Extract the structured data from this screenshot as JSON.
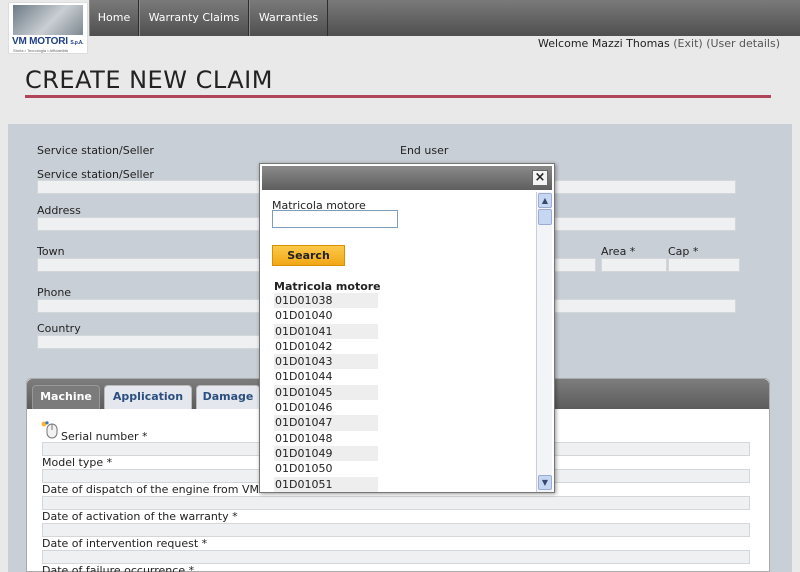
{
  "logo": {
    "brand": "VM MOTORI",
    "suffix": "S.p.A.",
    "tagline": "Storia • Tecnologia • Affidabilità"
  },
  "nav": {
    "home": "Home",
    "claims": "Warranty Claims",
    "warranties": "Warranties"
  },
  "user": {
    "welcome": "Welcome Mazzi Thomas",
    "exit": "(Exit)",
    "details": "(User details)"
  },
  "page": {
    "title": "CREATE NEW CLAIM"
  },
  "form": {
    "seller_heading": "Service station/Seller",
    "end_user_heading": "End user",
    "seller_label": "Service station/Seller",
    "address_label": "Address",
    "town_label": "Town",
    "area_label": "Area *",
    "cap_label": "Cap *",
    "phone_label": "Phone",
    "country_label": "Country"
  },
  "tabs": [
    "Machine",
    "Application",
    "Damage"
  ],
  "machine": {
    "serial": "Serial number *",
    "model": "Model type *",
    "dispatch": "Date of dispatch of the engine from VM *",
    "activation": "Date of activation of the warranty *",
    "intervention": "Date of intervention request *",
    "failure": "Date of failure occurrence *"
  },
  "modal": {
    "field_label": "Matricola motore",
    "input_value": "",
    "search_label": "Search",
    "results_header": "Matricola motore",
    "results": [
      "01D01038",
      "01D01040",
      "01D01041",
      "01D01042",
      "01D01043",
      "01D01044",
      "01D01045",
      "01D01046",
      "01D01047",
      "01D01048",
      "01D01049",
      "01D01050",
      "01D01051"
    ]
  },
  "colors": {
    "accent": "#b0445a",
    "nav": "#5e5e5e",
    "search_button": "#f6b72a",
    "tab_text": "#2c4f80"
  },
  "icons": {
    "close": "close-icon",
    "mouse": "mouse-icon",
    "scroll_up": "scroll-up-icon",
    "scroll_down": "scroll-down-icon"
  }
}
